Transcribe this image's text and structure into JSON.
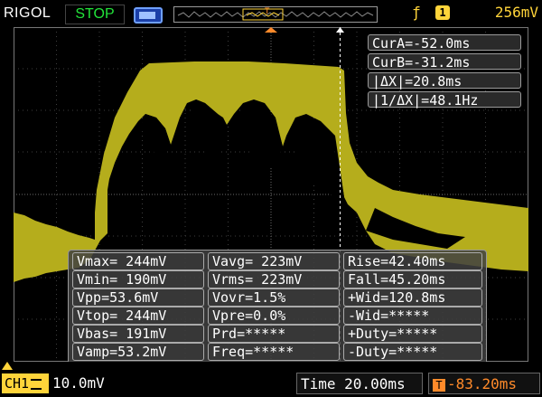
{
  "header": {
    "brand": "RIGOL",
    "run_status": "STOP",
    "trigger_edge_symbol": "ƒ",
    "trigger_source": "1",
    "trigger_level": "256mV"
  },
  "cursors": {
    "cur_a": "CurA=-52.0ms",
    "cur_b": "CurB=-31.2ms",
    "delta_x": "|ΔX|=20.8ms",
    "inv_delta_x": "|1/ΔX|=48.1Hz"
  },
  "measurements": {
    "col1": [
      "Vmax= 244mV",
      "Vmin= 190mV",
      "Vpp=53.6mV",
      "Vtop= 244mV",
      "Vbas= 191mV",
      "Vamp=53.2mV"
    ],
    "col2": [
      "Vavg= 223mV",
      "Vrms= 223mV",
      "Vovr=1.5%",
      "Vpre=0.0%",
      "Prd=*****",
      "Freq=*****"
    ],
    "col3": [
      "Rise=42.40ms",
      "Fall=45.20ms",
      "+Wid=120.8ms",
      "-Wid=*****",
      "+Duty=*****",
      "-Duty=*****"
    ]
  },
  "footer": {
    "channel_label": "CH1",
    "channel_scale": "10.0mV",
    "timebase": "Time 20.00ms",
    "trigger_offset": "-83.20ms"
  },
  "colors": {
    "trace": "#b5ad1c",
    "channel": "#ffd43a",
    "status_stop": "#22e53a",
    "offset": "#ff8a2a"
  }
}
